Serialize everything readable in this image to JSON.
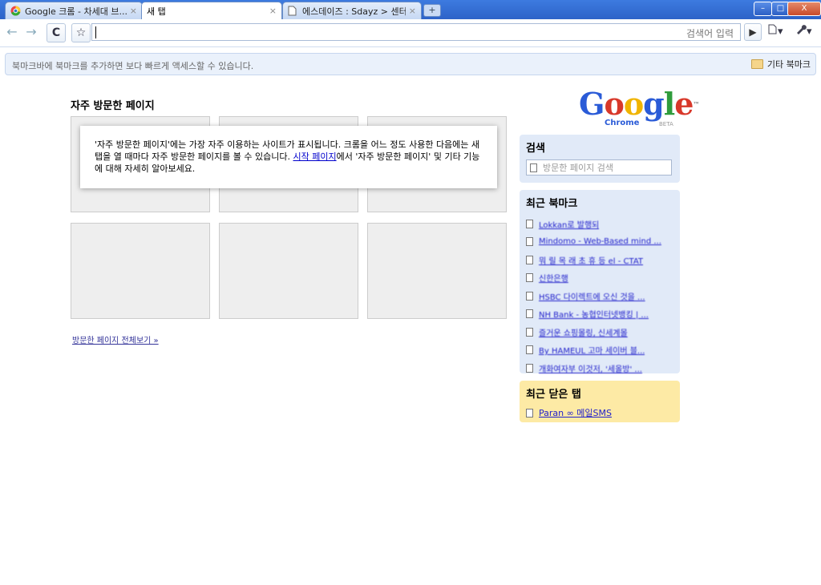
{
  "tabs": [
    {
      "label": "Google 크롬 - 차세대 브...",
      "close": "×",
      "favicon": "chrome-icon"
    },
    {
      "label": "새 탭",
      "close": "×",
      "favicon": "none"
    },
    {
      "label": "에스데이즈 : Sdayz > 센터",
      "close": "×",
      "favicon": "page-icon"
    }
  ],
  "new_tab_symbol": "+",
  "window_controls": {
    "minimize": "–",
    "maximize": "□",
    "close": "X"
  },
  "toolbar": {
    "back": "←",
    "forward": "→",
    "reload": "C",
    "star": "☆",
    "go": "▶",
    "page_menu": "▾",
    "tools_menu": "▾"
  },
  "omnibox": {
    "hint": "검색어 입력",
    "value": ""
  },
  "bookmark_bar": {
    "message": "북마크바에 북마크를 추가하면 보다 빠르게 액세스할 수 있습니다.",
    "other_bookmarks": "기타 북마크"
  },
  "most_visited": {
    "title": "자주 방문한 페이지",
    "notice_before_link": "'자주 방문한 페이지'에는 가장 자주 이용하는 사이트가 표시됩니다. 크롬을 어느 정도 사용한 다음에는 새 탭을 열 때마다 자주 방문한 페이지를 볼 수 있습니다. ",
    "notice_link": "시작 페이지",
    "notice_after_link": "에서 '자주 방문한 페이지' 및 기타 기능에 대해 자세히 알아보세요.",
    "view_all": "방문한 페이지 전체보기 »"
  },
  "logo": {
    "g1": "G",
    "o1": "o",
    "o2": "o",
    "g2": "g",
    "l": "l",
    "e": "e",
    "tm": "™",
    "product": "Chrome",
    "beta": "BETA"
  },
  "search_panel": {
    "title": "검색",
    "placeholder": "방문한 페이지 검색"
  },
  "recent_bookmarks": {
    "title": "최근 북마크",
    "items": [
      "Lokkan로 발행되",
      "Mindomo - Web-Based mind ...",
      "뭐 릴 목 래 초 휴 등 el - CTAT",
      "신한은행",
      "HSBC 다이렉트에 오신 것을 ...",
      "NH Bank - 농협인터넷뱅킹 | ...",
      "즐거운 쇼핑몰링, 신세계몰",
      "By HAMEUL 고마 세이버 블...",
      "개화여자부 이것저, '세올방' ..."
    ]
  },
  "recent_closed": {
    "title": "최근 닫은 탭",
    "items": [
      "Paran ∞ 메일SMS"
    ]
  },
  "colors": {
    "tab_strip": "#2d63c8",
    "panel_blue": "#e1eaf8",
    "panel_yellow": "#fdeaa5",
    "link": "#2222cc"
  }
}
